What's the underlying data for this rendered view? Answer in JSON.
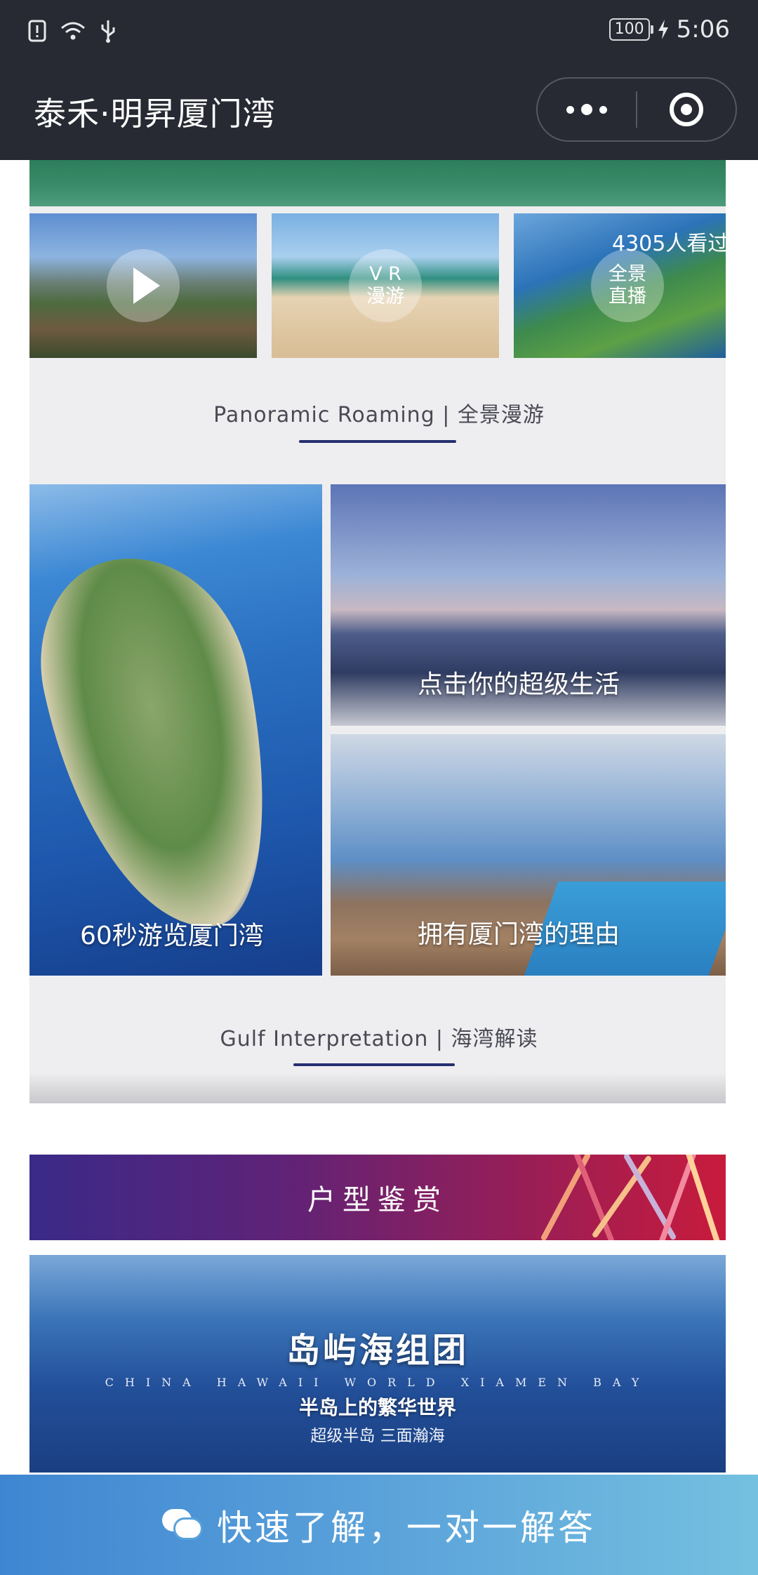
{
  "status_bar": {
    "battery": "100",
    "time": "5:06"
  },
  "nav": {
    "title": "泰禾·明昇厦门湾"
  },
  "panorama": {
    "vr_label": "V R\n漫游",
    "live_label": "全景\n直播",
    "viewers": "4305人看过",
    "section_title": "Panoramic Roaming | 全景漫游"
  },
  "tiles": {
    "big_label": "60秒游览厦门湾",
    "top_right_label": "点击你的超级生活",
    "bottom_right_label": "拥有厦门湾的理由"
  },
  "gulf": {
    "section_title": "Gulf Interpretation | 海湾解读"
  },
  "banner": {
    "label": "户型鉴赏"
  },
  "promo": {
    "title": "岛屿海组团",
    "english": "CHINA HAWAII WORLD XIAMEN BAY",
    "subtitle": "半岛上的繁华世界",
    "subtitle2": "超级半岛 三面瀚海"
  },
  "cta": {
    "label": "快速了解，一对一解答"
  },
  "colors": {
    "nav_bg": "#272a33",
    "accent_line": "#243070",
    "cta_start": "#3f86d2",
    "cta_end": "#74c0e0"
  }
}
